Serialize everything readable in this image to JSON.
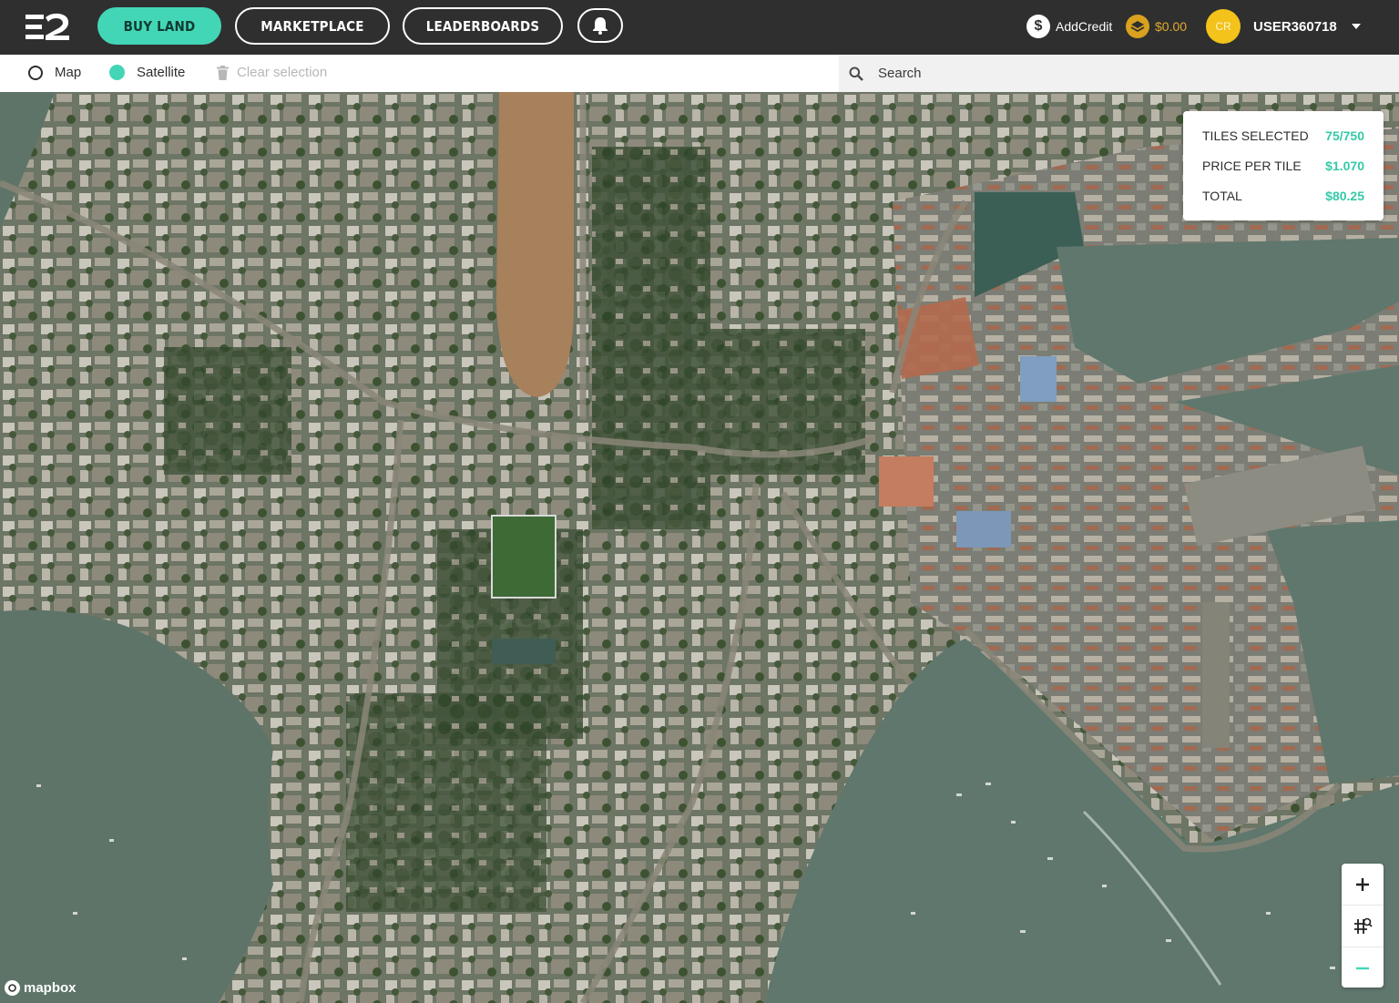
{
  "nav": {
    "buy_land": "BUY LAND",
    "marketplace": "MARKETPLACE",
    "leaderboards": "LEADERBOARDS"
  },
  "account": {
    "add_credit": "AddCredit",
    "balance": "$0.00",
    "avatar_initials": "CR",
    "username": "USER360718"
  },
  "toolbar": {
    "map_label": "Map",
    "satellite_label": "Satellite",
    "clear_label": "Clear selection",
    "selected_view": "Satellite"
  },
  "search": {
    "placeholder": "Search"
  },
  "stats": {
    "tiles_selected_label": "TILES SELECTED",
    "tiles_selected_value": "75/750",
    "price_label": "PRICE PER TILE",
    "price_value": "$1.070",
    "total_label": "TOTAL",
    "total_value": "$80.25"
  },
  "attribution": "mapbox",
  "colors": {
    "accent": "#43d6b6",
    "topbar": "#2f2f2f",
    "coin": "#d8a21e",
    "avatar": "#f3c21b"
  },
  "icons": [
    "bell-icon",
    "dollar-icon",
    "coin-icon",
    "trash-icon",
    "search-icon",
    "plus-icon",
    "grid-search-icon",
    "minus-icon",
    "mapbox-icon"
  ]
}
